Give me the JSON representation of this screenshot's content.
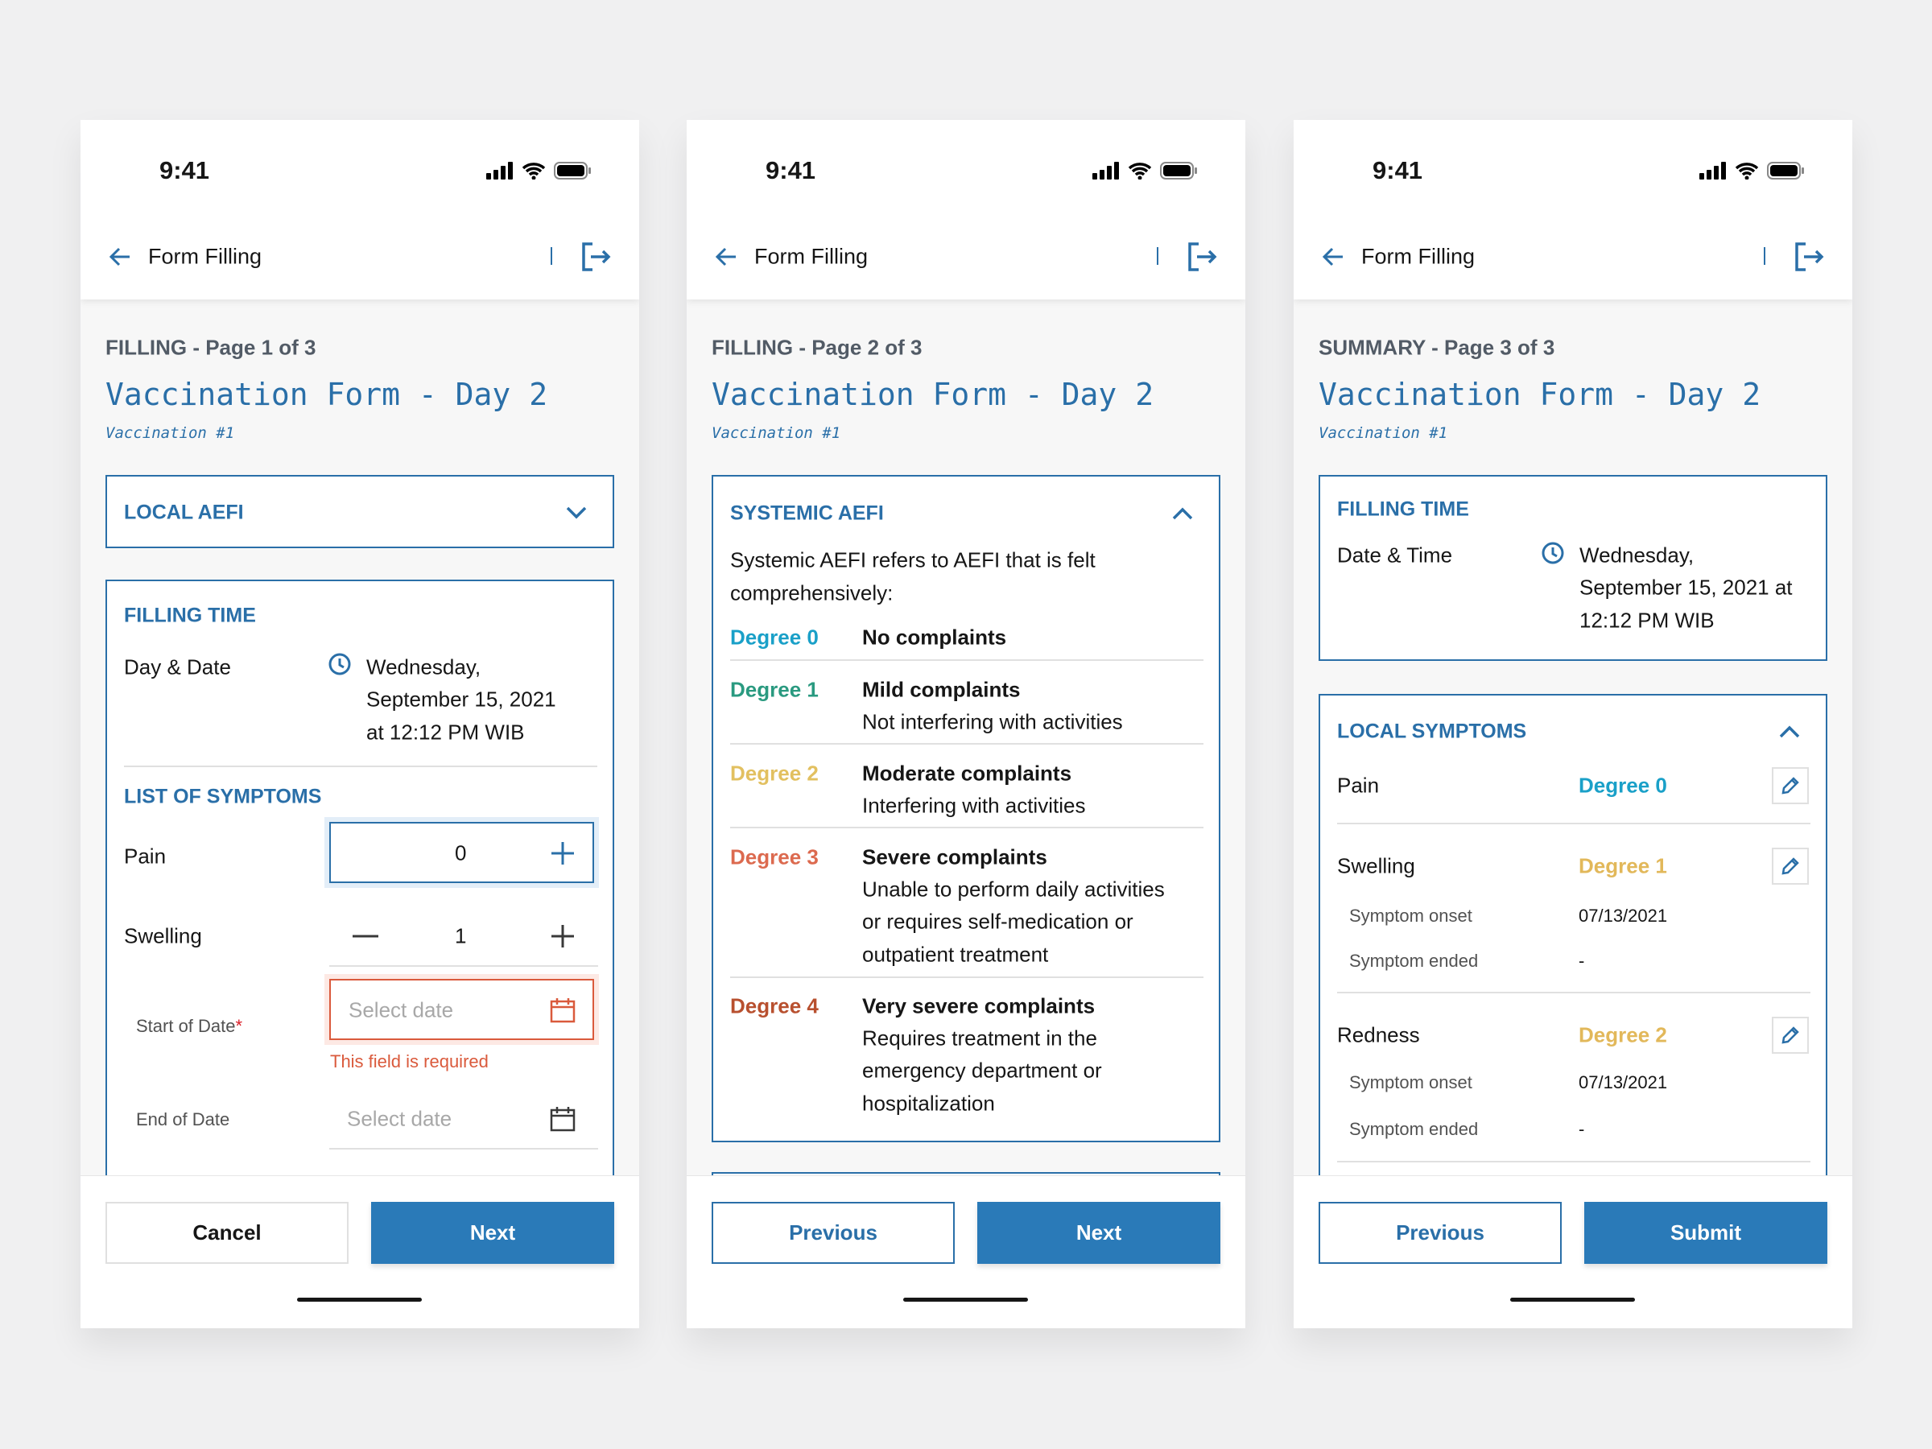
{
  "status_time": "9:41",
  "header_title": "Form Filling",
  "form_title": "Vaccination Form - Day 2",
  "form_subtitle": "Vaccination #1",
  "colors": {
    "primary": "#2a6fa8",
    "button": "#2a7ab8",
    "error": "#da5a3c",
    "degree0": "#1aa0c8",
    "degree1": "#2a9a80",
    "degree2": "#e2c060",
    "degree3": "#dc6a4f",
    "degree4": "#b8502f"
  },
  "screen1": {
    "page_label": "FILLING - Page 1 of 3",
    "accordion": "LOCAL AEFI",
    "filling_time_title": "FILLING TIME",
    "date_label": "Day & Date",
    "date_lines": [
      "Wednesday,",
      "September 15, 2021",
      "at 12:12 PM WIB"
    ],
    "symptoms_title": "LIST OF SYMPTOMS",
    "pain_label": "Pain",
    "pain_value": "0",
    "swelling_label": "Swelling",
    "swelling_value": "1",
    "start_label": "Start of Date",
    "required_mark": "*",
    "start_placeholder": "Select date",
    "error": "This field is required",
    "end_label": "End of Date",
    "end_placeholder": "Select date",
    "cancel": "Cancel",
    "next": "Next"
  },
  "screen2": {
    "page_label": "FILLING - Page 2 of 3",
    "section": "SYSTEMIC AEFI",
    "desc_lines": [
      "Systemic AEFI refers to AEFI that is felt",
      "comprehensively:"
    ],
    "degrees": [
      {
        "label": "Degree 0",
        "title": "No complaints",
        "lines": []
      },
      {
        "label": "Degree 1",
        "title": "Mild complaints",
        "lines": [
          "Not interfering with activities"
        ]
      },
      {
        "label": "Degree 2",
        "title": "Moderate complaints",
        "lines": [
          "Interfering with activities"
        ]
      },
      {
        "label": "Degree 3",
        "title": "Severe complaints",
        "lines": [
          "Unable to perform daily activities",
          "or requires self-medication or",
          "outpatient treatment"
        ]
      },
      {
        "label": "Degree 4",
        "title": "Very severe complaints",
        "lines": [
          "Requires treatment in the",
          "emergency department or",
          "hospitalization"
        ]
      }
    ],
    "previous": "Previous",
    "next": "Next"
  },
  "screen3": {
    "page_label": "SUMMARY - Page 3 of 3",
    "filling_time_title": "FILLING TIME",
    "date_label": "Date & Time",
    "date_lines": [
      "Wednesday,",
      "September 15, 2021 at",
      "12:12 PM WIB"
    ],
    "symptoms_title": "LOCAL SYMPTOMS",
    "symptoms": [
      {
        "name": "Pain",
        "degree": "Degree 0"
      },
      {
        "name": "Swelling",
        "degree": "Degree 1",
        "onset_label": "Symptom onset",
        "onset": "07/13/2021",
        "ended_label": "Symptom ended",
        "ended": "-"
      },
      {
        "name": "Redness",
        "degree": "Degree 2",
        "onset_label": "Symptom onset",
        "onset": "07/13/2021",
        "ended_label": "Symptom ended",
        "ended": "-"
      }
    ],
    "previous": "Previous",
    "submit": "Submit"
  }
}
